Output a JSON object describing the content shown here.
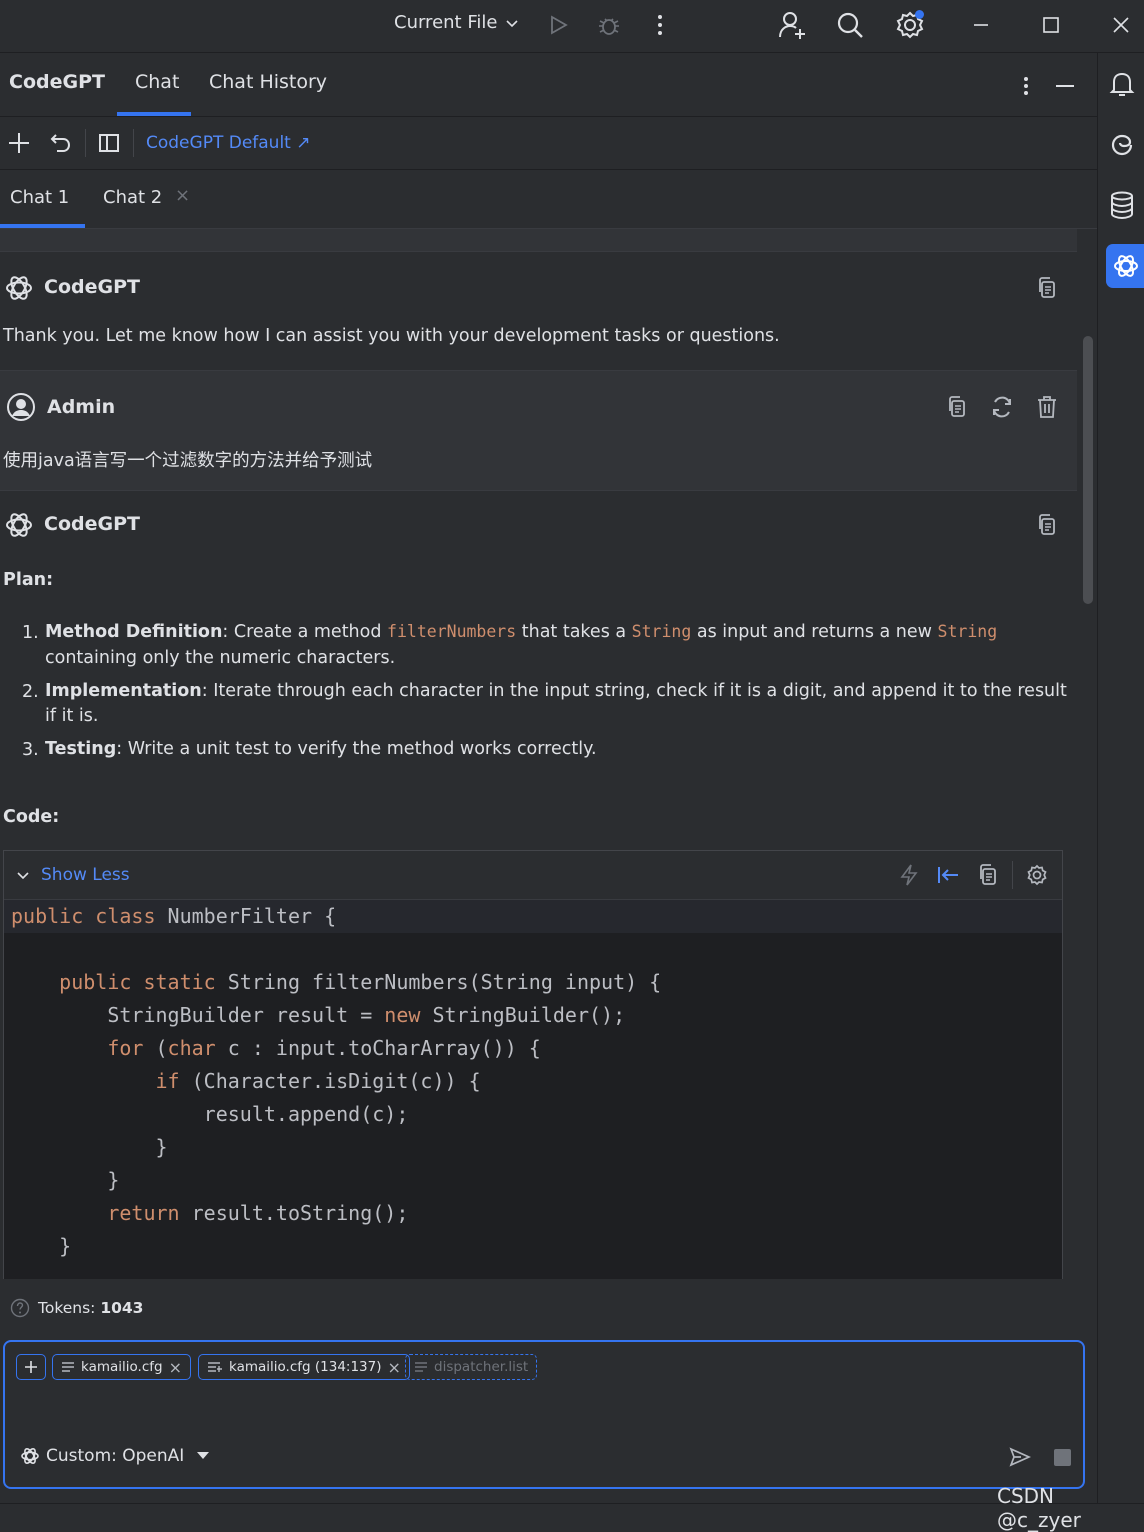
{
  "titlebar": {
    "run_config": "Current File",
    "icons": [
      "chevron-down-icon",
      "run-icon",
      "debug-icon",
      "more-icon",
      "add-user-icon",
      "search-icon",
      "settings-icon",
      "minimize-icon",
      "maximize-icon",
      "close-icon"
    ],
    "notification_dot_color": "#3574f0"
  },
  "tool_window": {
    "title": "CodeGPT",
    "tabs": [
      {
        "label": "Chat",
        "active": true
      },
      {
        "label": "Chat History",
        "active": false
      }
    ]
  },
  "toolbar": {
    "persona_link": "CodeGPT Default ↗"
  },
  "chat_tabs": [
    {
      "label": "Chat 1",
      "active": true
    },
    {
      "label": "Chat 2",
      "active": false,
      "close": "×"
    }
  ],
  "messages": [
    {
      "author": "CodeGPT",
      "text": "Thank you. Let me know how I can assist you with your development tasks or questions."
    },
    {
      "author": "Admin",
      "text": "使用java语言写一个过滤数字的方法并给予测试"
    },
    {
      "author": "CodeGPT",
      "plan_heading": "Plan:",
      "plan": [
        {
          "num": "1.",
          "title": "Method Definition",
          "parts": [
            ": Create a method ",
            "filterNumbers",
            " that takes a ",
            "String",
            " as input and returns a new ",
            "String"
          ],
          "line2": "containing only the numeric characters."
        },
        {
          "num": "2.",
          "title": "Implementation",
          "line1": ": Iterate through each character in the input string, check if it is a digit, and append it to the result",
          "line2": "if it is."
        },
        {
          "num": "3.",
          "title": "Testing",
          "line1": ": Write a unit test to verify the method works correctly."
        }
      ],
      "code_heading": "Code:",
      "code_toggle": "Show Less",
      "code": [
        [
          {
            "t": "public class ",
            "k": true
          },
          {
            "t": "NumberFilter {",
            "k": false
          }
        ],
        [],
        [
          {
            "t": "    public static ",
            "k": true
          },
          {
            "t": "String filterNumbers(String input) {",
            "k": false
          }
        ],
        [
          {
            "t": "        StringBuilder result = ",
            "k": false
          },
          {
            "t": "new ",
            "k": true
          },
          {
            "t": "StringBuilder();",
            "k": false
          }
        ],
        [
          {
            "t": "        for ",
            "k": true
          },
          {
            "t": "(",
            "k": false
          },
          {
            "t": "char ",
            "k": true
          },
          {
            "t": "c : input.toCharArray()) {",
            "k": false
          }
        ],
        [
          {
            "t": "            if ",
            "k": true
          },
          {
            "t": "(Character.isDigit(c)) {",
            "k": false
          }
        ],
        [
          {
            "t": "                result.append(c);",
            "k": false
          }
        ],
        [
          {
            "t": "            }",
            "k": false
          }
        ],
        [
          {
            "t": "        }",
            "k": false
          }
        ],
        [
          {
            "t": "        return ",
            "k": true
          },
          {
            "t": "result.toString();",
            "k": false
          }
        ],
        [
          {
            "t": "    }",
            "k": false
          }
        ]
      ]
    }
  ],
  "tokens": {
    "label": "Tokens: ",
    "value": "1043"
  },
  "input": {
    "chips": [
      {
        "label": "kamailio.cfg",
        "style": "solid"
      },
      {
        "label": "kamailio.cfg (134:137)",
        "style": "solid"
      },
      {
        "label": "dispatcher.list",
        "style": "dashed"
      }
    ],
    "model": "Custom: OpenAI"
  },
  "watermark": "CSDN @c_zyer",
  "colors": {
    "accent": "#3574f0",
    "keyword": "#cf8e6d",
    "background": "#2b2d30"
  }
}
